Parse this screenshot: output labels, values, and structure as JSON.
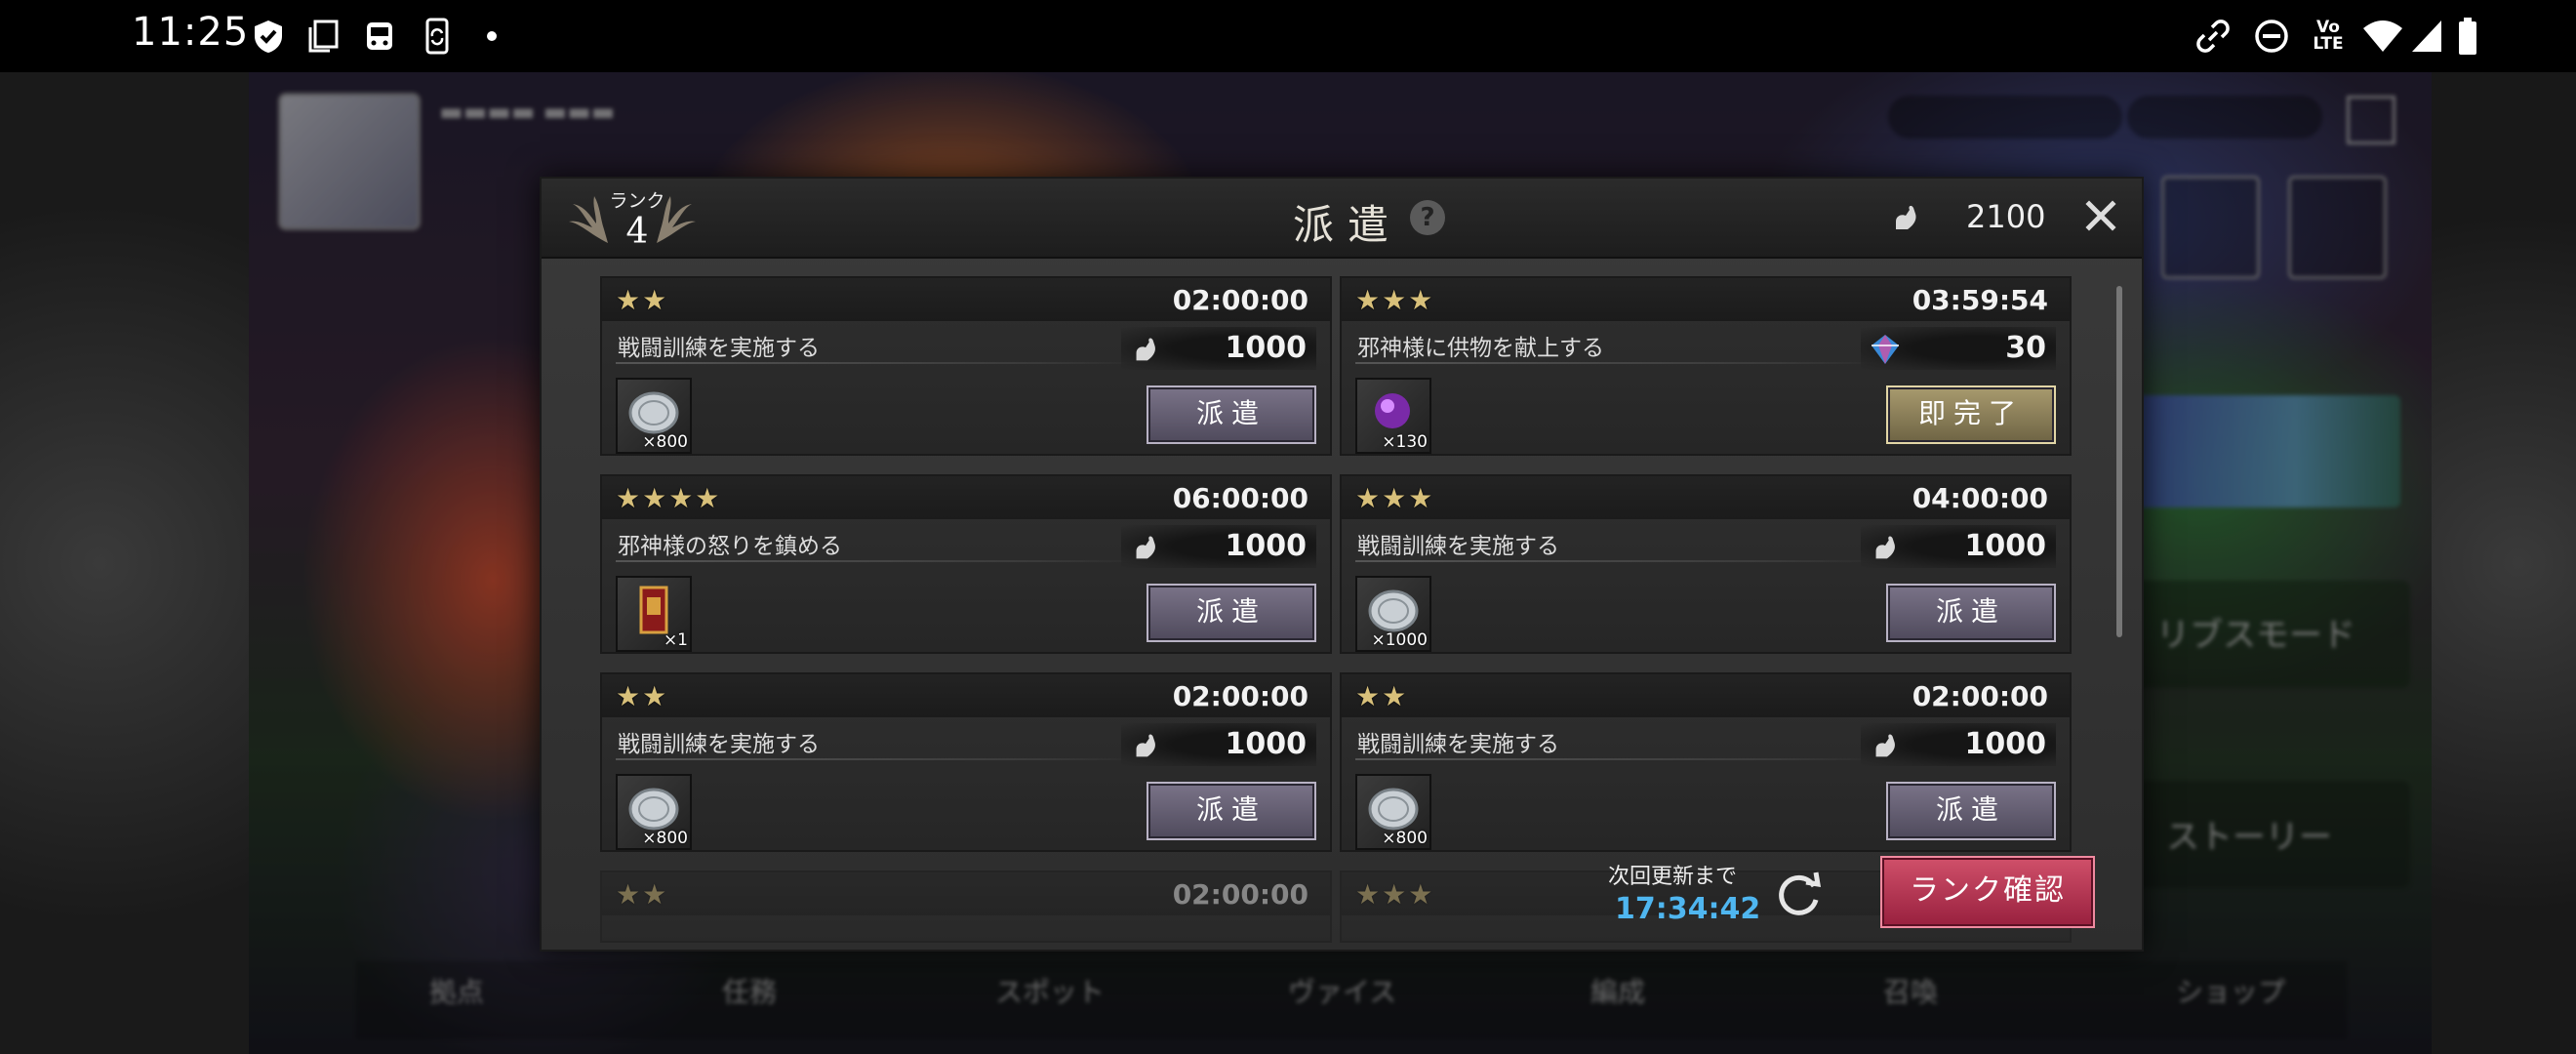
{
  "status_bar": {
    "time": "11:25",
    "left_icons": [
      "shield-check-icon",
      "copy-icon",
      "train-icon",
      "phone-sync-icon",
      "dot-icon"
    ],
    "right_icons": [
      "link-icon",
      "do-not-disturb-icon",
      "volte-icon",
      "wifi-icon",
      "signal-icon",
      "battery-icon"
    ],
    "volte_label": "Vo LTE"
  },
  "dialog": {
    "rank_label": "ランク",
    "rank_value": "4",
    "title": "派遣",
    "stamina": "2100",
    "missions": [
      {
        "stars": "★★",
        "timer": "02:00:00",
        "name": "戦闘訓練を実施する",
        "cost": "1000",
        "cost_type": "stamina",
        "reward_icon": "silver-coin-icon",
        "reward_qty": "×800",
        "action": "派遣",
        "action_type": "dispatch"
      },
      {
        "stars": "★★★",
        "timer": "03:59:54",
        "name": "邪神様に供物を献上する",
        "cost": "30",
        "cost_type": "gem",
        "reward_icon": "purple-orb-icon",
        "reward_qty": "×130",
        "action": "即完了",
        "action_type": "instant"
      },
      {
        "stars": "★★★★",
        "timer": "06:00:00",
        "name": "邪神様の怒りを鎮める",
        "cost": "1000",
        "cost_type": "stamina",
        "reward_icon": "red-book-icon",
        "reward_qty": "×1",
        "action": "派遣",
        "action_type": "dispatch"
      },
      {
        "stars": "★★★",
        "timer": "04:00:00",
        "name": "戦闘訓練を実施する",
        "cost": "1000",
        "cost_type": "stamina",
        "reward_icon": "silver-coin-icon",
        "reward_qty": "×1000",
        "action": "派遣",
        "action_type": "dispatch"
      },
      {
        "stars": "★★",
        "timer": "02:00:00",
        "name": "戦闘訓練を実施する",
        "cost": "1000",
        "cost_type": "stamina",
        "reward_icon": "silver-coin-icon",
        "reward_qty": "×800",
        "action": "派遣",
        "action_type": "dispatch"
      },
      {
        "stars": "★★",
        "timer": "02:00:00",
        "name": "戦闘訓練を実施する",
        "cost": "1000",
        "cost_type": "stamina",
        "reward_icon": "silver-coin-icon",
        "reward_qty": "×800",
        "action": "派遣",
        "action_type": "dispatch"
      },
      {
        "stars": "★★",
        "timer": "02:00:00"
      },
      {
        "stars": "★★★",
        "timer": ""
      }
    ],
    "next_update_label": "次回更新まで",
    "next_update_timer": "17:34:42",
    "rank_check_label": "ランク確認"
  },
  "background": {
    "nav_items": [
      "拠点",
      "任務",
      "スポット",
      "ヴァイス",
      "編成",
      "召喚",
      "ショップ"
    ],
    "mode_label": "リブスモード",
    "story_label": "ストーリー"
  },
  "colors": {
    "timer_blue": "#4fb6f0",
    "star_gold": "#d8c07a",
    "rank_button": "#c03a58",
    "instant_button": "#a89a6e"
  }
}
